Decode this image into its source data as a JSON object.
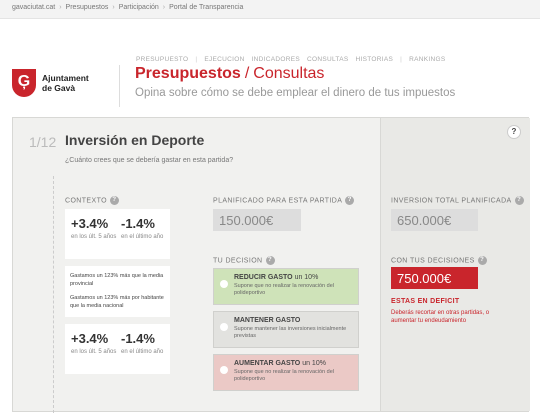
{
  "breadcrumb": [
    "gavaciutat.cat",
    "Presupuestos",
    "Participación",
    "Portal de Transparencia"
  ],
  "logo": {
    "glyph": "Ģ",
    "line1": "Ajuntament",
    "line2": "de Gavà"
  },
  "nav": [
    "PRESUPUESTO",
    "EJECUCION",
    "INDICADORES",
    "CONSULTAS",
    "HISTORIAS",
    "RANKINGS"
  ],
  "page_title": {
    "main": "Presupuestos",
    "slash": "/",
    "section": "Consultas"
  },
  "page_subtitle": "Opina sobre cómo se debe emplear el dinero de tus impuestos",
  "question": {
    "number": "1/12",
    "title": "Inversión en Deporte",
    "subtitle": "¿Cuánto crees que se debería gastar en esta partida?"
  },
  "help_big": "?",
  "help_small": "?",
  "context": {
    "label": "CONTEXTO",
    "stats1": [
      {
        "value": "+3.4%",
        "note": "en los últ. 5 años"
      },
      {
        "value": "-1.4%",
        "note": "en el último año"
      }
    ],
    "text1": "Gastamos un 123% más que la media provincial",
    "text2": "Gastamos un 123% más por habitante que la media nacional",
    "stats2": [
      {
        "value": "+3.4%",
        "note": "en los últ. 5 años"
      },
      {
        "value": "-1.4%",
        "note": "en el último año"
      }
    ]
  },
  "planned": {
    "label": "PLANIFICADO PARA ESTA PARTIDA",
    "value": "150.000€"
  },
  "decision": {
    "label": "TU DECISION",
    "options": [
      {
        "label": "REDUCIR GASTO",
        "amount": "un 10%",
        "desc": "Supone que no realizar la renovación del polideportivo",
        "color": "#cfe3b9"
      },
      {
        "label": "MANTENER GASTO",
        "amount": "",
        "desc": "Supone mantener las inversiones inicialmente previstas",
        "color": "#e2e2df"
      },
      {
        "label": "AUMENTAR GASTO",
        "amount": "un 10%",
        "desc": "Supone que no realizar la renovación del polideportivo",
        "color": "#ebc9c6"
      }
    ]
  },
  "total": {
    "label": "INVERSION TOTAL PLANIFICADA",
    "value": "650.000€"
  },
  "your_decisions": {
    "label": "CON TUS DECISIONES",
    "value": "750.000€"
  },
  "deficit": {
    "label": "ESTAS EN DEFICIT",
    "desc": "Deberás recortar en otras partidas, o aumentar tu endeudamiento"
  },
  "colors": {
    "accent": "#c9252c"
  }
}
